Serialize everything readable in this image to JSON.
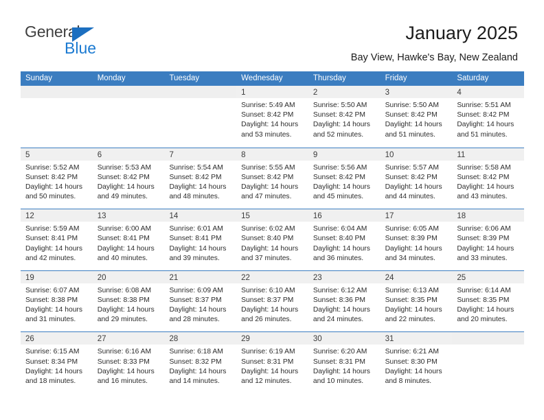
{
  "brand": {
    "name_part1": "General",
    "name_part2": "Blue",
    "triangle_icon": "triangle-icon",
    "accent_blue": "#1b7ad1",
    "header_blue": "#3b7dc0"
  },
  "header": {
    "month_title": "January 2025",
    "location": "Bay View, Hawke's Bay, New Zealand"
  },
  "weekdays": [
    "Sunday",
    "Monday",
    "Tuesday",
    "Wednesday",
    "Thursday",
    "Friday",
    "Saturday"
  ],
  "weeks": [
    [
      {
        "empty": true
      },
      {
        "empty": true
      },
      {
        "empty": true
      },
      {
        "day": "1",
        "sunrise": "Sunrise: 5:49 AM",
        "sunset": "Sunset: 8:42 PM",
        "daylight1": "Daylight: 14 hours",
        "daylight2": "and 53 minutes."
      },
      {
        "day": "2",
        "sunrise": "Sunrise: 5:50 AM",
        "sunset": "Sunset: 8:42 PM",
        "daylight1": "Daylight: 14 hours",
        "daylight2": "and 52 minutes."
      },
      {
        "day": "3",
        "sunrise": "Sunrise: 5:50 AM",
        "sunset": "Sunset: 8:42 PM",
        "daylight1": "Daylight: 14 hours",
        "daylight2": "and 51 minutes."
      },
      {
        "day": "4",
        "sunrise": "Sunrise: 5:51 AM",
        "sunset": "Sunset: 8:42 PM",
        "daylight1": "Daylight: 14 hours",
        "daylight2": "and 51 minutes."
      }
    ],
    [
      {
        "day": "5",
        "sunrise": "Sunrise: 5:52 AM",
        "sunset": "Sunset: 8:42 PM",
        "daylight1": "Daylight: 14 hours",
        "daylight2": "and 50 minutes."
      },
      {
        "day": "6",
        "sunrise": "Sunrise: 5:53 AM",
        "sunset": "Sunset: 8:42 PM",
        "daylight1": "Daylight: 14 hours",
        "daylight2": "and 49 minutes."
      },
      {
        "day": "7",
        "sunrise": "Sunrise: 5:54 AM",
        "sunset": "Sunset: 8:42 PM",
        "daylight1": "Daylight: 14 hours",
        "daylight2": "and 48 minutes."
      },
      {
        "day": "8",
        "sunrise": "Sunrise: 5:55 AM",
        "sunset": "Sunset: 8:42 PM",
        "daylight1": "Daylight: 14 hours",
        "daylight2": "and 47 minutes."
      },
      {
        "day": "9",
        "sunrise": "Sunrise: 5:56 AM",
        "sunset": "Sunset: 8:42 PM",
        "daylight1": "Daylight: 14 hours",
        "daylight2": "and 45 minutes."
      },
      {
        "day": "10",
        "sunrise": "Sunrise: 5:57 AM",
        "sunset": "Sunset: 8:42 PM",
        "daylight1": "Daylight: 14 hours",
        "daylight2": "and 44 minutes."
      },
      {
        "day": "11",
        "sunrise": "Sunrise: 5:58 AM",
        "sunset": "Sunset: 8:42 PM",
        "daylight1": "Daylight: 14 hours",
        "daylight2": "and 43 minutes."
      }
    ],
    [
      {
        "day": "12",
        "sunrise": "Sunrise: 5:59 AM",
        "sunset": "Sunset: 8:41 PM",
        "daylight1": "Daylight: 14 hours",
        "daylight2": "and 42 minutes."
      },
      {
        "day": "13",
        "sunrise": "Sunrise: 6:00 AM",
        "sunset": "Sunset: 8:41 PM",
        "daylight1": "Daylight: 14 hours",
        "daylight2": "and 40 minutes."
      },
      {
        "day": "14",
        "sunrise": "Sunrise: 6:01 AM",
        "sunset": "Sunset: 8:41 PM",
        "daylight1": "Daylight: 14 hours",
        "daylight2": "and 39 minutes."
      },
      {
        "day": "15",
        "sunrise": "Sunrise: 6:02 AM",
        "sunset": "Sunset: 8:40 PM",
        "daylight1": "Daylight: 14 hours",
        "daylight2": "and 37 minutes."
      },
      {
        "day": "16",
        "sunrise": "Sunrise: 6:04 AM",
        "sunset": "Sunset: 8:40 PM",
        "daylight1": "Daylight: 14 hours",
        "daylight2": "and 36 minutes."
      },
      {
        "day": "17",
        "sunrise": "Sunrise: 6:05 AM",
        "sunset": "Sunset: 8:39 PM",
        "daylight1": "Daylight: 14 hours",
        "daylight2": "and 34 minutes."
      },
      {
        "day": "18",
        "sunrise": "Sunrise: 6:06 AM",
        "sunset": "Sunset: 8:39 PM",
        "daylight1": "Daylight: 14 hours",
        "daylight2": "and 33 minutes."
      }
    ],
    [
      {
        "day": "19",
        "sunrise": "Sunrise: 6:07 AM",
        "sunset": "Sunset: 8:38 PM",
        "daylight1": "Daylight: 14 hours",
        "daylight2": "and 31 minutes."
      },
      {
        "day": "20",
        "sunrise": "Sunrise: 6:08 AM",
        "sunset": "Sunset: 8:38 PM",
        "daylight1": "Daylight: 14 hours",
        "daylight2": "and 29 minutes."
      },
      {
        "day": "21",
        "sunrise": "Sunrise: 6:09 AM",
        "sunset": "Sunset: 8:37 PM",
        "daylight1": "Daylight: 14 hours",
        "daylight2": "and 28 minutes."
      },
      {
        "day": "22",
        "sunrise": "Sunrise: 6:10 AM",
        "sunset": "Sunset: 8:37 PM",
        "daylight1": "Daylight: 14 hours",
        "daylight2": "and 26 minutes."
      },
      {
        "day": "23",
        "sunrise": "Sunrise: 6:12 AM",
        "sunset": "Sunset: 8:36 PM",
        "daylight1": "Daylight: 14 hours",
        "daylight2": "and 24 minutes."
      },
      {
        "day": "24",
        "sunrise": "Sunrise: 6:13 AM",
        "sunset": "Sunset: 8:35 PM",
        "daylight1": "Daylight: 14 hours",
        "daylight2": "and 22 minutes."
      },
      {
        "day": "25",
        "sunrise": "Sunrise: 6:14 AM",
        "sunset": "Sunset: 8:35 PM",
        "daylight1": "Daylight: 14 hours",
        "daylight2": "and 20 minutes."
      }
    ],
    [
      {
        "day": "26",
        "sunrise": "Sunrise: 6:15 AM",
        "sunset": "Sunset: 8:34 PM",
        "daylight1": "Daylight: 14 hours",
        "daylight2": "and 18 minutes."
      },
      {
        "day": "27",
        "sunrise": "Sunrise: 6:16 AM",
        "sunset": "Sunset: 8:33 PM",
        "daylight1": "Daylight: 14 hours",
        "daylight2": "and 16 minutes."
      },
      {
        "day": "28",
        "sunrise": "Sunrise: 6:18 AM",
        "sunset": "Sunset: 8:32 PM",
        "daylight1": "Daylight: 14 hours",
        "daylight2": "and 14 minutes."
      },
      {
        "day": "29",
        "sunrise": "Sunrise: 6:19 AM",
        "sunset": "Sunset: 8:31 PM",
        "daylight1": "Daylight: 14 hours",
        "daylight2": "and 12 minutes."
      },
      {
        "day": "30",
        "sunrise": "Sunrise: 6:20 AM",
        "sunset": "Sunset: 8:31 PM",
        "daylight1": "Daylight: 14 hours",
        "daylight2": "and 10 minutes."
      },
      {
        "day": "31",
        "sunrise": "Sunrise: 6:21 AM",
        "sunset": "Sunset: 8:30 PM",
        "daylight1": "Daylight: 14 hours",
        "daylight2": "and 8 minutes."
      },
      {
        "empty": true
      }
    ]
  ]
}
